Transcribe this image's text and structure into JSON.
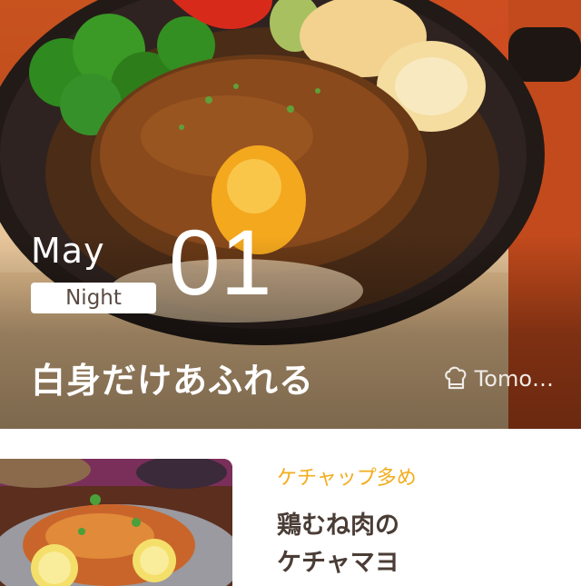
{
  "featured": {
    "month": "May",
    "time_of_day": "Night",
    "day": "01",
    "title": "白身だけあふれる",
    "author": "Tomo…",
    "author_icon": "chef-hat-icon"
  },
  "recipe_card": {
    "tag": "ケチャップ多め",
    "title_line1": "鶏むね肉の",
    "title_line2": "ケチャマヨ"
  },
  "colors": {
    "tag_accent": "#f3ad1d",
    "title_text": "#4a3d36",
    "badge_text": "#5a4b43"
  }
}
